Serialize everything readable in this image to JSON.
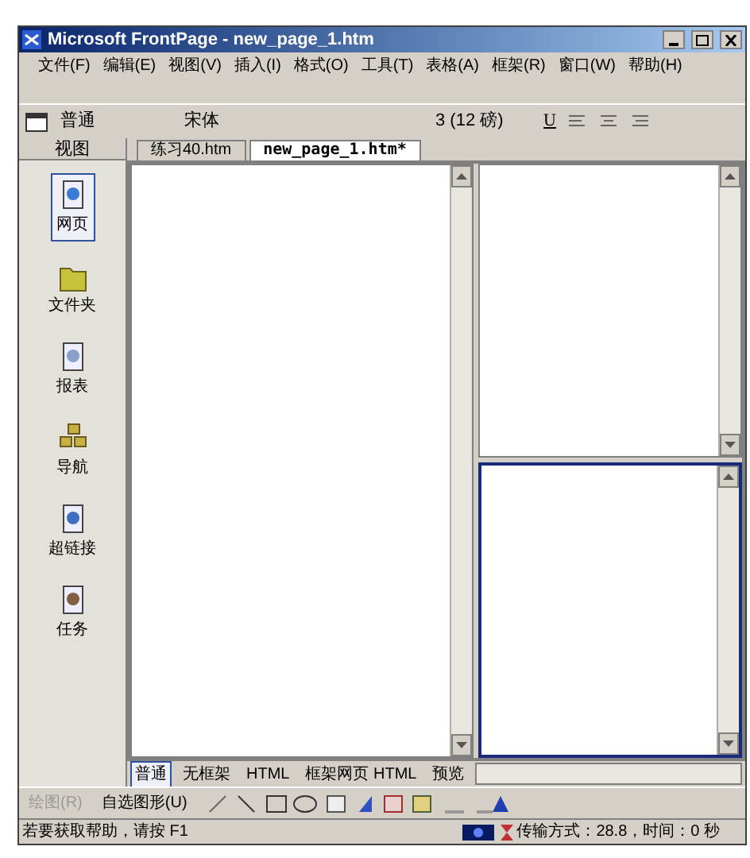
{
  "window": {
    "title": "Microsoft FrontPage - new_page_1.htm"
  },
  "menu": [
    "文件(F)",
    "编辑(E)",
    "视图(V)",
    "插入(I)",
    "格式(O)",
    "工具(T)",
    "表格(A)",
    "框架(R)",
    "窗口(W)",
    "帮助(H)"
  ],
  "toolbar": {
    "style": "普通",
    "font": "宋体",
    "size": "3  (12 磅)",
    "underline": "U"
  },
  "views": {
    "title": "视图",
    "items": [
      {
        "label": "网页",
        "selected": true
      },
      {
        "label": "文件夹",
        "selected": false
      },
      {
        "label": "报表",
        "selected": false
      },
      {
        "label": "导航",
        "selected": false
      },
      {
        "label": "超链接",
        "selected": false
      },
      {
        "label": "任务",
        "selected": false
      }
    ]
  },
  "doc_tabs": [
    {
      "label": "练习40.htm",
      "selected": false
    },
    {
      "label": "new_page_1.htm*",
      "selected": true
    }
  ],
  "frames": [
    {
      "selected": false
    },
    {
      "selected": false
    },
    {
      "selected": true
    }
  ],
  "mode_tabs": [
    {
      "label": "普通",
      "selected": true
    },
    {
      "label": "无框架",
      "selected": false
    },
    {
      "label": "HTML",
      "selected": false
    },
    {
      "label": "框架网页 HTML",
      "selected": false
    },
    {
      "label": "预览",
      "selected": false
    }
  ],
  "drawing_toolbar": {
    "draw": {
      "label": "绘图(R)",
      "disabled": true
    },
    "autoshapes": "自选图形(U)"
  },
  "status_bar": {
    "help": "若要获取帮助，请按 F1",
    "transfer": "传输方式：28.8，时间：0 秒"
  }
}
